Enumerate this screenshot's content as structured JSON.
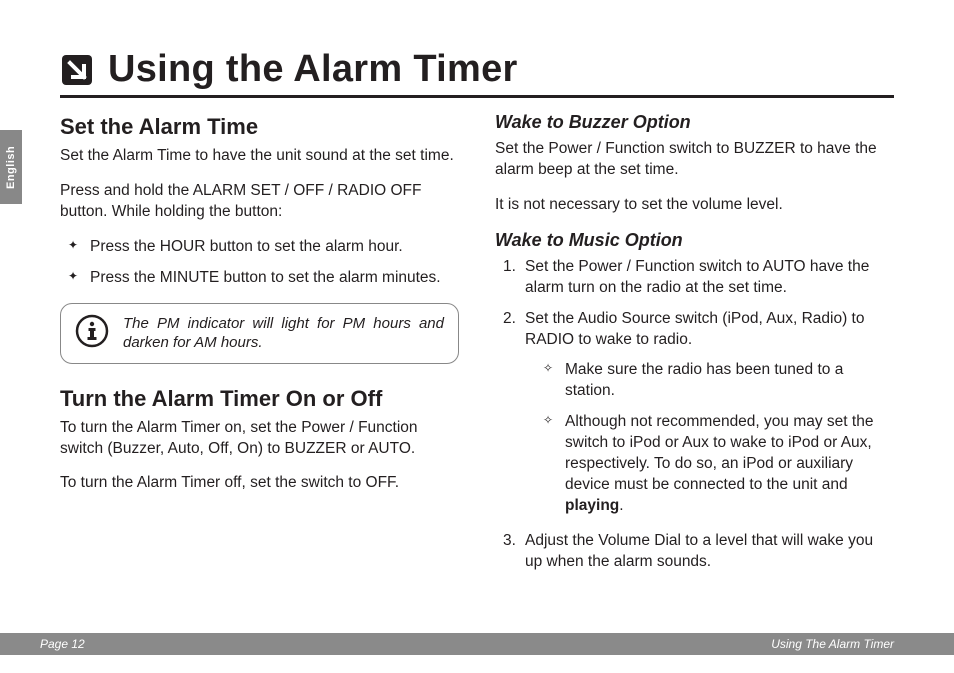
{
  "sidebar": {
    "language": "English"
  },
  "title": "Using the Alarm Timer",
  "left": {
    "section1": {
      "heading": "Set the Alarm Time",
      "p1": "Set the Alarm Time to have the unit sound at the set time.",
      "p2": "Press and hold the ALARM SET / OFF / RADIO OFF button. While holding the button:",
      "bullets": [
        "Press the HOUR button to set the alarm hour.",
        "Press the MINUTE button to set the alarm minutes."
      ],
      "info": "The PM indicator will light for PM hours and darken for AM hours."
    },
    "section2": {
      "heading": "Turn the Alarm Timer On or Off",
      "p1": "To turn the Alarm Timer on, set the Power / Function switch (Buzzer, Auto, Off, On) to BUZZER or AUTO.",
      "p2": "To turn the Alarm Timer off, set the switch to OFF."
    }
  },
  "right": {
    "buzzer": {
      "heading": "Wake to Buzzer Option",
      "p1": "Set the Power / Function switch to BUZZER to have the alarm beep at the set time.",
      "p2": "It is not necessary to set the volume level."
    },
    "music": {
      "heading": "Wake to Music Option",
      "steps": {
        "s1": "Set the Power / Function switch to AUTO have the alarm turn on the radio at the set time.",
        "s2": "Set the Audio Source switch (iPod, Aux, Radio) to RADIO to wake to radio.",
        "sub1": "Make sure the radio has been tuned to a station.",
        "sub2_pre": "Although not recommended, you may set the switch to iPod or Aux to wake to iPod or Aux, respectively. To do so, an iPod or auxiliary device must be connected to the unit and ",
        "sub2_bold": "playing",
        "sub2_post": ".",
        "s3": "Adjust the Volume Dial to a level that will wake you up when the alarm sounds."
      }
    }
  },
  "footer": {
    "left": "Page 12",
    "right": "Using The Alarm Timer"
  }
}
